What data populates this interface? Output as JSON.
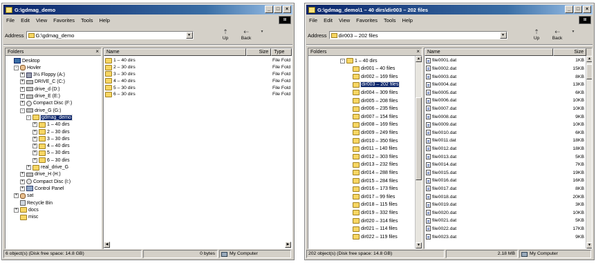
{
  "window1": {
    "title": "G:\\gdmag_demo",
    "menu": [
      "File",
      "Edit",
      "View",
      "Favorites",
      "Tools",
      "Help"
    ],
    "address_label": "Address",
    "address_value": "G:\\gdmag_demo",
    "nav_up": "Up",
    "nav_back": "Back",
    "folders_header": "Folders",
    "columns": {
      "name": "Name",
      "size": "Size",
      "type": "Type"
    },
    "tree": [
      {
        "label": "Desktop",
        "icon": "desktop-icon",
        "level": 0,
        "exp": ""
      },
      {
        "label": "Hovler",
        "icon": "user-icon",
        "level": 1,
        "exp": "-"
      },
      {
        "label": "3½ Floppy (A:)",
        "icon": "floppy-icon",
        "level": 2,
        "exp": "+"
      },
      {
        "label": "DRIVE_C (C:)",
        "icon": "drive-icon",
        "level": 2,
        "exp": "+"
      },
      {
        "label": "drive_d (D:)",
        "icon": "drive-icon",
        "level": 2,
        "exp": "+"
      },
      {
        "label": "drive_E (E:)",
        "icon": "drive-icon",
        "level": 2,
        "exp": "+"
      },
      {
        "label": "Compact Disc (F:)",
        "icon": "cd-icon",
        "level": 2,
        "exp": "+"
      },
      {
        "label": "drive_G (G:)",
        "icon": "drive-icon",
        "level": 2,
        "exp": "-"
      },
      {
        "label": "gdmag_demo",
        "icon": "folder-icon",
        "level": 3,
        "exp": "-",
        "selected": true
      },
      {
        "label": "1 – 40 dirs",
        "icon": "folder-icon",
        "level": 4,
        "exp": "+"
      },
      {
        "label": "2 – 30 dirs",
        "icon": "folder-icon",
        "level": 4,
        "exp": "+"
      },
      {
        "label": "3 – 30 dirs",
        "icon": "folder-icon",
        "level": 4,
        "exp": "+"
      },
      {
        "label": "4 – 40 dirs",
        "icon": "folder-icon",
        "level": 4,
        "exp": "+"
      },
      {
        "label": "5 – 30 dirs",
        "icon": "folder-icon",
        "level": 4,
        "exp": "+"
      },
      {
        "label": "6 – 30 dirs",
        "icon": "folder-icon",
        "level": 4,
        "exp": "+"
      },
      {
        "label": "real_drive_G",
        "icon": "folder-icon",
        "level": 3,
        "exp": "+"
      },
      {
        "label": "drive_H (H:)",
        "icon": "drive-icon",
        "level": 2,
        "exp": "+"
      },
      {
        "label": "Compact Disc (I:)",
        "icon": "cd-icon",
        "level": 2,
        "exp": "+"
      },
      {
        "label": "Control Panel",
        "icon": "panel-icon",
        "level": 2,
        "exp": "+"
      },
      {
        "label": "sat",
        "icon": "user-icon",
        "level": 1,
        "exp": "+"
      },
      {
        "label": "Recycle Bin",
        "icon": "recycle-icon",
        "level": 1,
        "exp": ""
      },
      {
        "label": "docs",
        "icon": "folder-icon",
        "level": 1,
        "exp": "+"
      },
      {
        "label": "misc",
        "icon": "folder-icon",
        "level": 1,
        "exp": ""
      }
    ],
    "files": [
      {
        "name": "1 – 40 dirs",
        "size": "",
        "type": "File Fold"
      },
      {
        "name": "2 – 30 dirs",
        "size": "",
        "type": "File Fold"
      },
      {
        "name": "3 – 30 dirs",
        "size": "",
        "type": "File Fold"
      },
      {
        "name": "4 – 40 dirs",
        "size": "",
        "type": "File Fold"
      },
      {
        "name": "5 – 30 dirs",
        "size": "",
        "type": "File Fold"
      },
      {
        "name": "6 – 30 dirs",
        "size": "",
        "type": "File Fold"
      }
    ],
    "status": {
      "objects": "6 object(s) (Disk free space: 14.8 GB)",
      "size": "0 bytes",
      "location": "My Computer"
    }
  },
  "window2": {
    "title": "G:\\gdmag_demo\\1 – 40 dirs\\dir003 – 202 files",
    "menu": [
      "File",
      "Edit",
      "View",
      "Favorites",
      "Tools",
      "Help"
    ],
    "address_label": "Address",
    "address_value": "dir003 – 202 files",
    "nav_up": "Up",
    "nav_back": "Back",
    "folders_header": "Folders",
    "columns": {
      "name": "Name",
      "size": "Size"
    },
    "tree": [
      {
        "label": "1 – 40 dirs",
        "level": 0,
        "exp": "-"
      },
      {
        "label": "dir001 – 40 files",
        "level": 1,
        "exp": ""
      },
      {
        "label": "dir002 – 169 files",
        "level": 1,
        "exp": ""
      },
      {
        "label": "dir003 – 202 files",
        "level": 1,
        "exp": "",
        "selected": true
      },
      {
        "label": "dir004 – 309 files",
        "level": 1,
        "exp": ""
      },
      {
        "label": "dir005 – 208 files",
        "level": 1,
        "exp": ""
      },
      {
        "label": "dir006 – 235 files",
        "level": 1,
        "exp": ""
      },
      {
        "label": "dir007 – 154 files",
        "level": 1,
        "exp": ""
      },
      {
        "label": "dir008 – 169 files",
        "level": 1,
        "exp": ""
      },
      {
        "label": "dir009 – 249 files",
        "level": 1,
        "exp": ""
      },
      {
        "label": "dir010 – 350 files",
        "level": 1,
        "exp": ""
      },
      {
        "label": "dir011 – 140 files",
        "level": 1,
        "exp": ""
      },
      {
        "label": "dir012 – 303 files",
        "level": 1,
        "exp": ""
      },
      {
        "label": "dir013 – 232 files",
        "level": 1,
        "exp": ""
      },
      {
        "label": "dir014 – 288 files",
        "level": 1,
        "exp": ""
      },
      {
        "label": "dir015 – 284 files",
        "level": 1,
        "exp": ""
      },
      {
        "label": "dir016 – 173 files",
        "level": 1,
        "exp": ""
      },
      {
        "label": "dir017 – 99 files",
        "level": 1,
        "exp": ""
      },
      {
        "label": "dir018 – 115 files",
        "level": 1,
        "exp": ""
      },
      {
        "label": "dir019 – 332 files",
        "level": 1,
        "exp": ""
      },
      {
        "label": "dir020 – 314 files",
        "level": 1,
        "exp": ""
      },
      {
        "label": "dir021 – 114 files",
        "level": 1,
        "exp": ""
      },
      {
        "label": "dir022 – 119 files",
        "level": 1,
        "exp": ""
      }
    ],
    "files": [
      {
        "name": "file0001.dat",
        "size": "1KB"
      },
      {
        "name": "file0002.dat",
        "size": "15KB"
      },
      {
        "name": "file0003.dat",
        "size": "8KB"
      },
      {
        "name": "file0004.dat",
        "size": "13KB"
      },
      {
        "name": "file0005.dat",
        "size": "6KB"
      },
      {
        "name": "file0006.dat",
        "size": "10KB"
      },
      {
        "name": "file0007.dat",
        "size": "10KB"
      },
      {
        "name": "file0008.dat",
        "size": "9KB"
      },
      {
        "name": "file0009.dat",
        "size": "10KB"
      },
      {
        "name": "file0010.dat",
        "size": "6KB"
      },
      {
        "name": "file0011.dat",
        "size": "18KB"
      },
      {
        "name": "file0012.dat",
        "size": "18KB"
      },
      {
        "name": "file0013.dat",
        "size": "5KB"
      },
      {
        "name": "file0014.dat",
        "size": "7KB"
      },
      {
        "name": "file0015.dat",
        "size": "19KB"
      },
      {
        "name": "file0016.dat",
        "size": "16KB"
      },
      {
        "name": "file0017.dat",
        "size": "8KB"
      },
      {
        "name": "file0018.dat",
        "size": "20KB"
      },
      {
        "name": "file0019.dat",
        "size": "3KB"
      },
      {
        "name": "file0020.dat",
        "size": "10KB"
      },
      {
        "name": "file0021.dat",
        "size": "5KB"
      },
      {
        "name": "file0022.dat",
        "size": "17KB"
      },
      {
        "name": "file0023.dat",
        "size": "9KB"
      }
    ],
    "status": {
      "objects": "202 object(s) (Disk free space: 14.8 GB)",
      "size": "2.18 MB",
      "location": "My Computer"
    }
  }
}
